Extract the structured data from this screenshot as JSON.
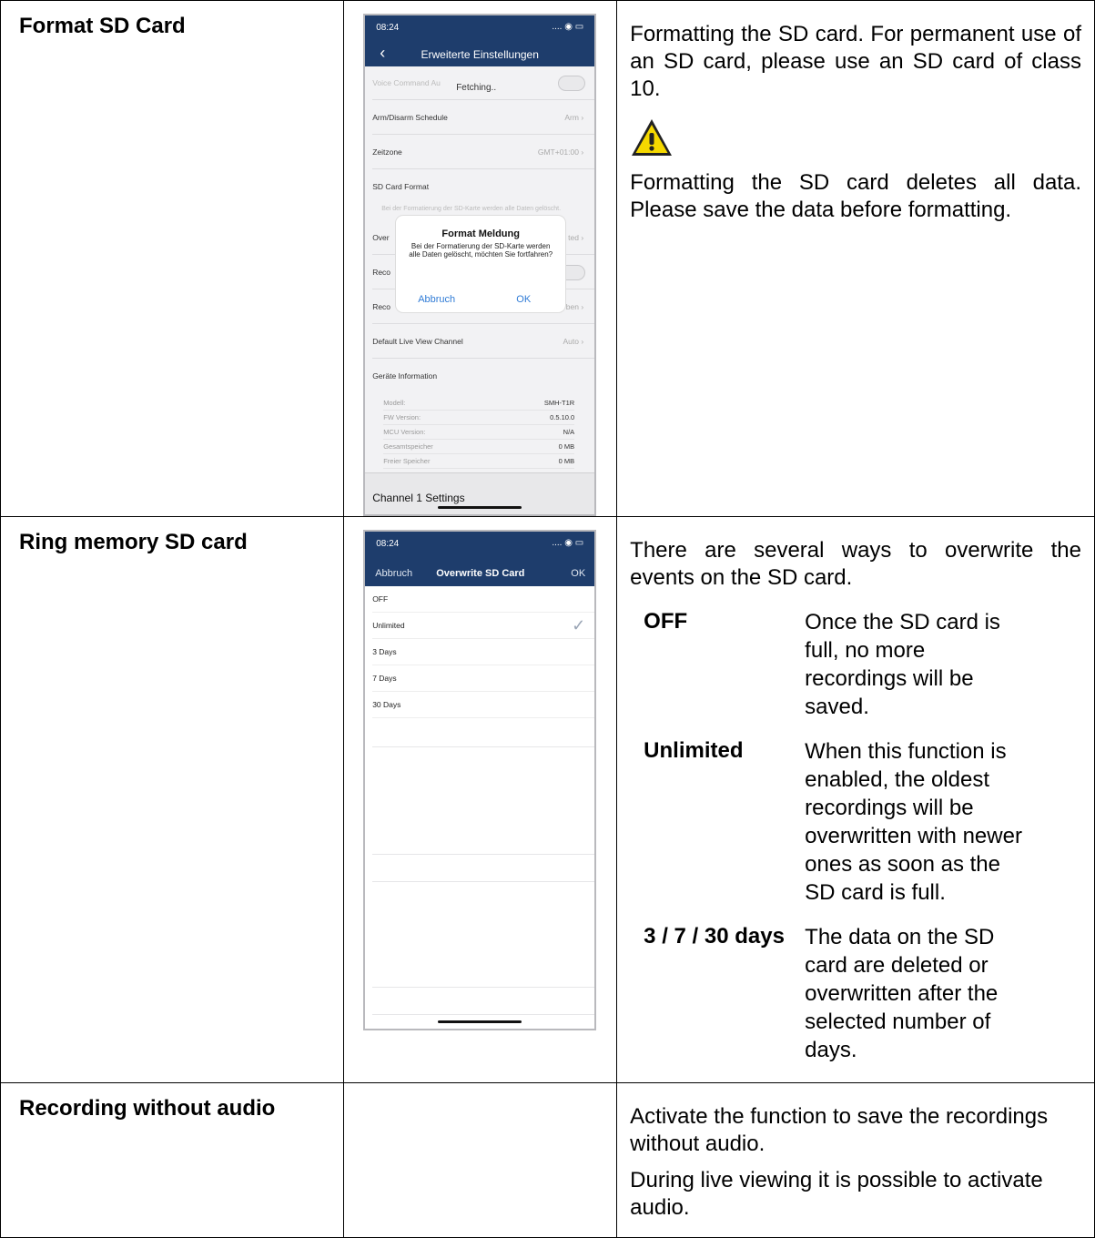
{
  "rows": [
    {
      "heading": "Format SD Card",
      "desc1": "Formatting the SD card. For permanent use of an SD card, please use an SD card of class 10.",
      "desc2": "Formatting the SD card deletes all data. Please save the data before formatting."
    },
    {
      "heading": "Ring memory SD card",
      "desc1": "There are several ways to overwrite the events on the SD card.",
      "options": [
        {
          "key": "OFF",
          "text": "Once the SD card is full, no more recordings will be saved."
        },
        {
          "key": "Unlimited",
          "text": "When this function is enabled, the oldest recordings will be overwritten with newer ones as soon as the SD card is full."
        },
        {
          "key": "3 / 7 / 30 days",
          "text": "The data on the SD card are deleted or overwritten after the selected number of days."
        }
      ]
    },
    {
      "heading": "Recording without audio",
      "desc1": "Activate the function to save the recordings without audio.",
      "desc2": "During live viewing it is possible to activate audio."
    }
  ],
  "phone1": {
    "time": "08:24",
    "status_icons": ".... ◉ ▭",
    "title": "Erweiterte Einstellungen",
    "fetching": "Fetching..",
    "voice_label": "Voice Command Au",
    "arm_label": "Arm/Disarm Schedule",
    "arm_value": "Arm",
    "zone_label": "Zeitzone",
    "zone_value": "GMT+01:00",
    "sd_label": "SD Card Format",
    "sd_note": "Bei der Formatierung der SD-Karte werden alle Daten gelöscht.",
    "over_label": "Over",
    "over_value": "ted",
    "rec1_label": "Reco",
    "rec2_label": "Reco",
    "rec2_value": "ben",
    "default_label": "Default Live View Channel",
    "default_value": "Auto",
    "info_title": "Geräte Information",
    "info": [
      {
        "k": "Modell:",
        "v": "SMH-T1R"
      },
      {
        "k": "FW Version:",
        "v": "0.5.10.0"
      },
      {
        "k": "MCU Version:",
        "v": "N/A"
      },
      {
        "k": "Gesamtspeicher",
        "v": "0 MB"
      },
      {
        "k": "Freier Speicher",
        "v": "0 MB"
      }
    ],
    "dialog_title": "Format Meldung",
    "dialog_msg": "Bei der Formatierung der SD-Karte werden alle Daten gelöscht, möchten Sie fortfahren?",
    "dialog_cancel": "Abbruch",
    "dialog_ok": "OK",
    "footer": "Channel 1 Settings"
  },
  "phone2": {
    "time": "08:24",
    "status_icons": ".... ◉ ▭",
    "cancel": "Abbruch",
    "title": "Overwrite SD Card",
    "ok": "OK",
    "options": [
      "OFF",
      "Unlimited",
      "3 Days",
      "7 Days",
      "30 Days"
    ],
    "selected": "Unlimited"
  }
}
